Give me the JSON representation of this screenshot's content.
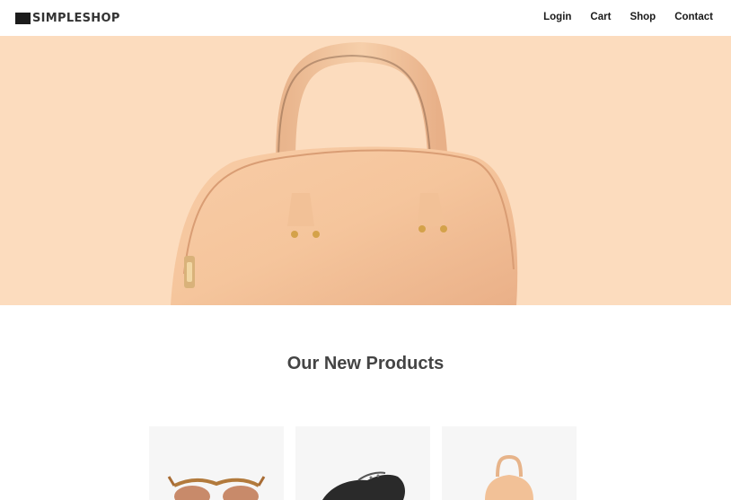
{
  "brand": {
    "name": "SIMPLESHOP"
  },
  "nav": {
    "links": [
      "Login",
      "Cart",
      "Shop",
      "Contact"
    ]
  },
  "hero": {
    "image": "handbag-image",
    "background_color": "#fcdcbe"
  },
  "products_section": {
    "title": "Our New Products",
    "products": [
      {
        "image": "sunglasses-image"
      },
      {
        "image": "shoe-image"
      },
      {
        "image": "handbag-image"
      }
    ]
  }
}
